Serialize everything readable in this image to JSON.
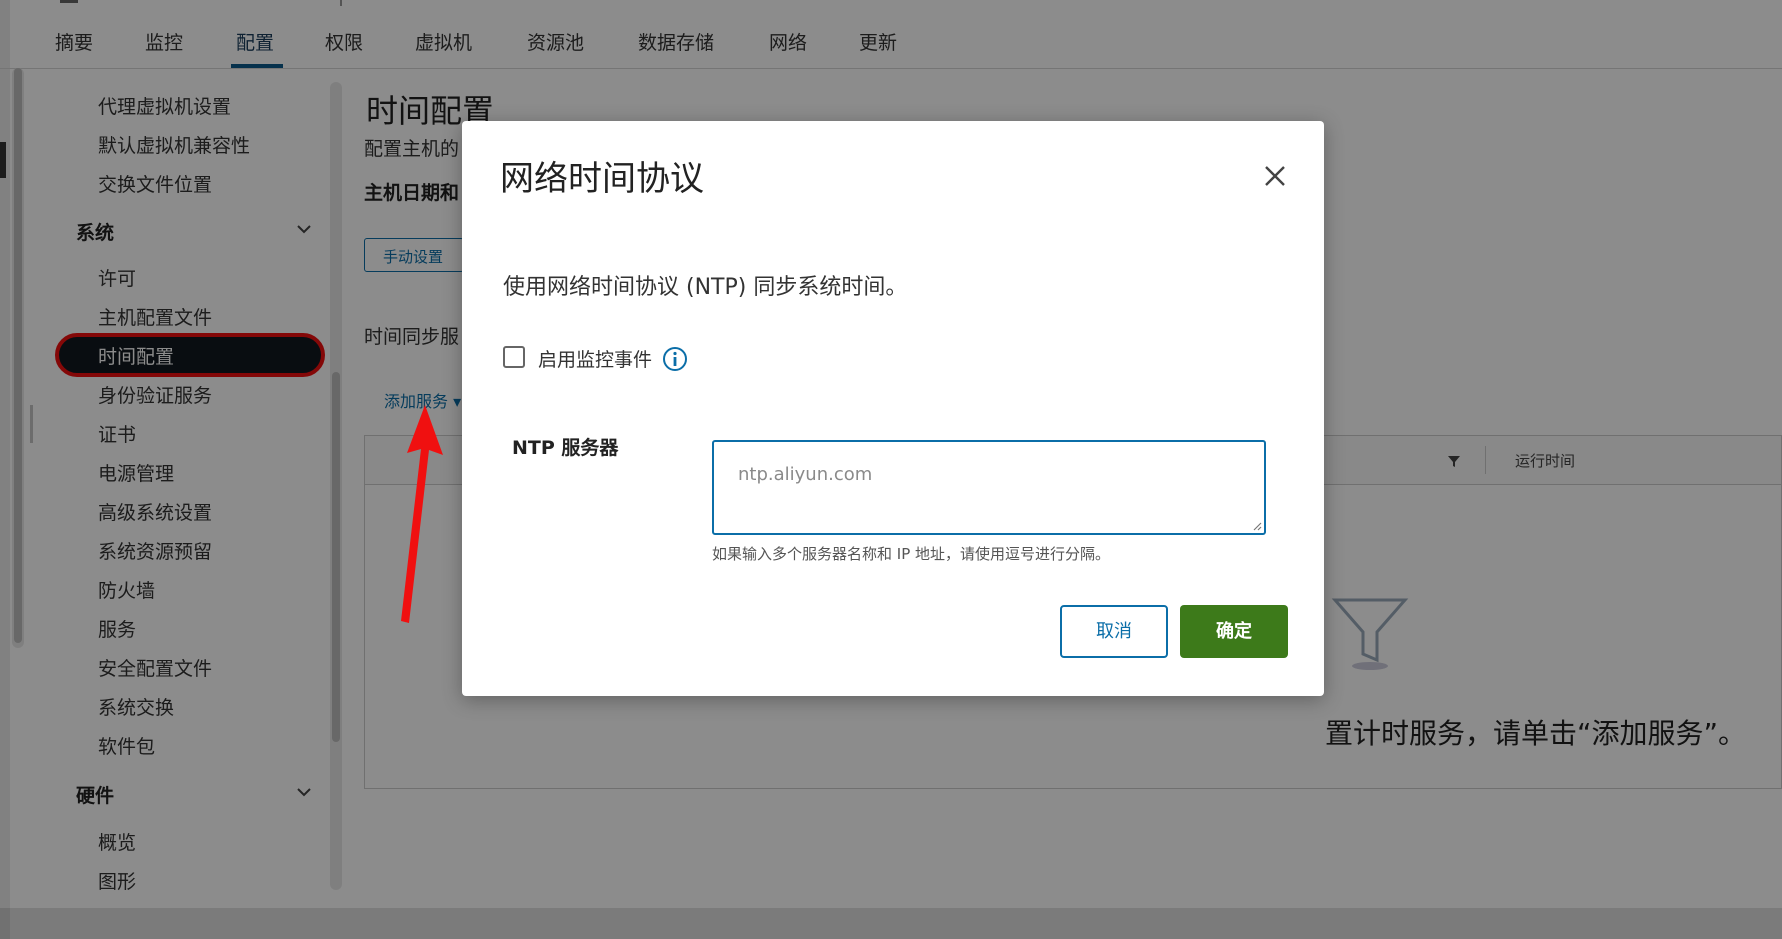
{
  "tabs": [
    {
      "label": "摘要"
    },
    {
      "label": "监控"
    },
    {
      "label": "配置"
    },
    {
      "label": "权限"
    },
    {
      "label": "虚拟机"
    },
    {
      "label": "资源池"
    },
    {
      "label": "数据存储"
    },
    {
      "label": "网络"
    },
    {
      "label": "更新"
    }
  ],
  "active_tab": "配置",
  "sidebar": {
    "items_top": [
      "代理虚拟机设置",
      "默认虚拟机兼容性",
      "交换文件位置"
    ],
    "group_system": "系统",
    "system_items": [
      "许可",
      "主机配置文件",
      "时间配置",
      "身份验证服务",
      "证书",
      "电源管理",
      "高级系统设置",
      "系统资源预留",
      "防火墙",
      "服务",
      "安全配置文件",
      "系统交换",
      "软件包"
    ],
    "group_hardware": "硬件",
    "hardware_items": [
      "概览",
      "图形"
    ],
    "active_item": "时间配置"
  },
  "content": {
    "title": "时间配置",
    "subtitle": "配置主机的",
    "host_datetime_label": "主机日期和",
    "manual_button": "手动设置",
    "sync_label": "时间同步服",
    "add_service_link": "添加服务",
    "add_service_caret": "▾",
    "runtime_column": "运行时间",
    "empty_message": "置计时服务，请单击“添加服务”。"
  },
  "modal": {
    "title": "网络时间协议",
    "description": "使用网络时间协议 (NTP) 同步系统时间。",
    "checkbox_label": "启用监控事件",
    "checkbox_checked": false,
    "ntp_label": "NTP 服务器",
    "ntp_placeholder": "ntp.aliyun.com",
    "ntp_value": "",
    "ntp_hint": "如果输入多个服务器名称和 IP 地址，请使用逗号进行分隔。",
    "cancel_label": "取消",
    "ok_label": "确定"
  },
  "colors": {
    "accent": "#0b6ea8",
    "primary_button": "#3d7a1a",
    "highlight_ring": "#f01010",
    "active_item_bg": "#12191f",
    "annotation_arrow": "#f01010"
  }
}
